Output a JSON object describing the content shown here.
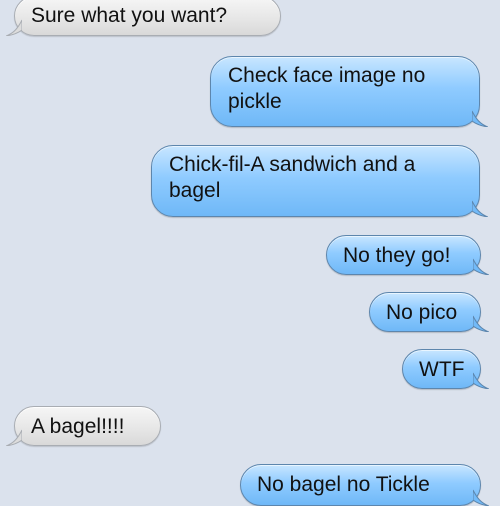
{
  "conversation": {
    "messages": [
      {
        "direction": "received",
        "lines": [
          "Sure what you want?"
        ]
      },
      {
        "direction": "sent",
        "lines": [
          "Check face image no",
          "pickle"
        ]
      },
      {
        "direction": "sent",
        "lines": [
          "Chick-fil-A sandwich and a",
          "bagel"
        ]
      },
      {
        "direction": "sent",
        "lines": [
          "No they go!"
        ]
      },
      {
        "direction": "sent",
        "lines": [
          "No pico"
        ]
      },
      {
        "direction": "sent",
        "lines": [
          "WTF"
        ]
      },
      {
        "direction": "received",
        "lines": [
          "A bagel!!!!"
        ]
      },
      {
        "direction": "sent",
        "lines": [
          "No bagel no  Tickle"
        ]
      }
    ]
  },
  "colors": {
    "background": "#dbe2ed",
    "received_bubble": "#e7e7e7",
    "sent_bubble": "#8fcbff"
  }
}
